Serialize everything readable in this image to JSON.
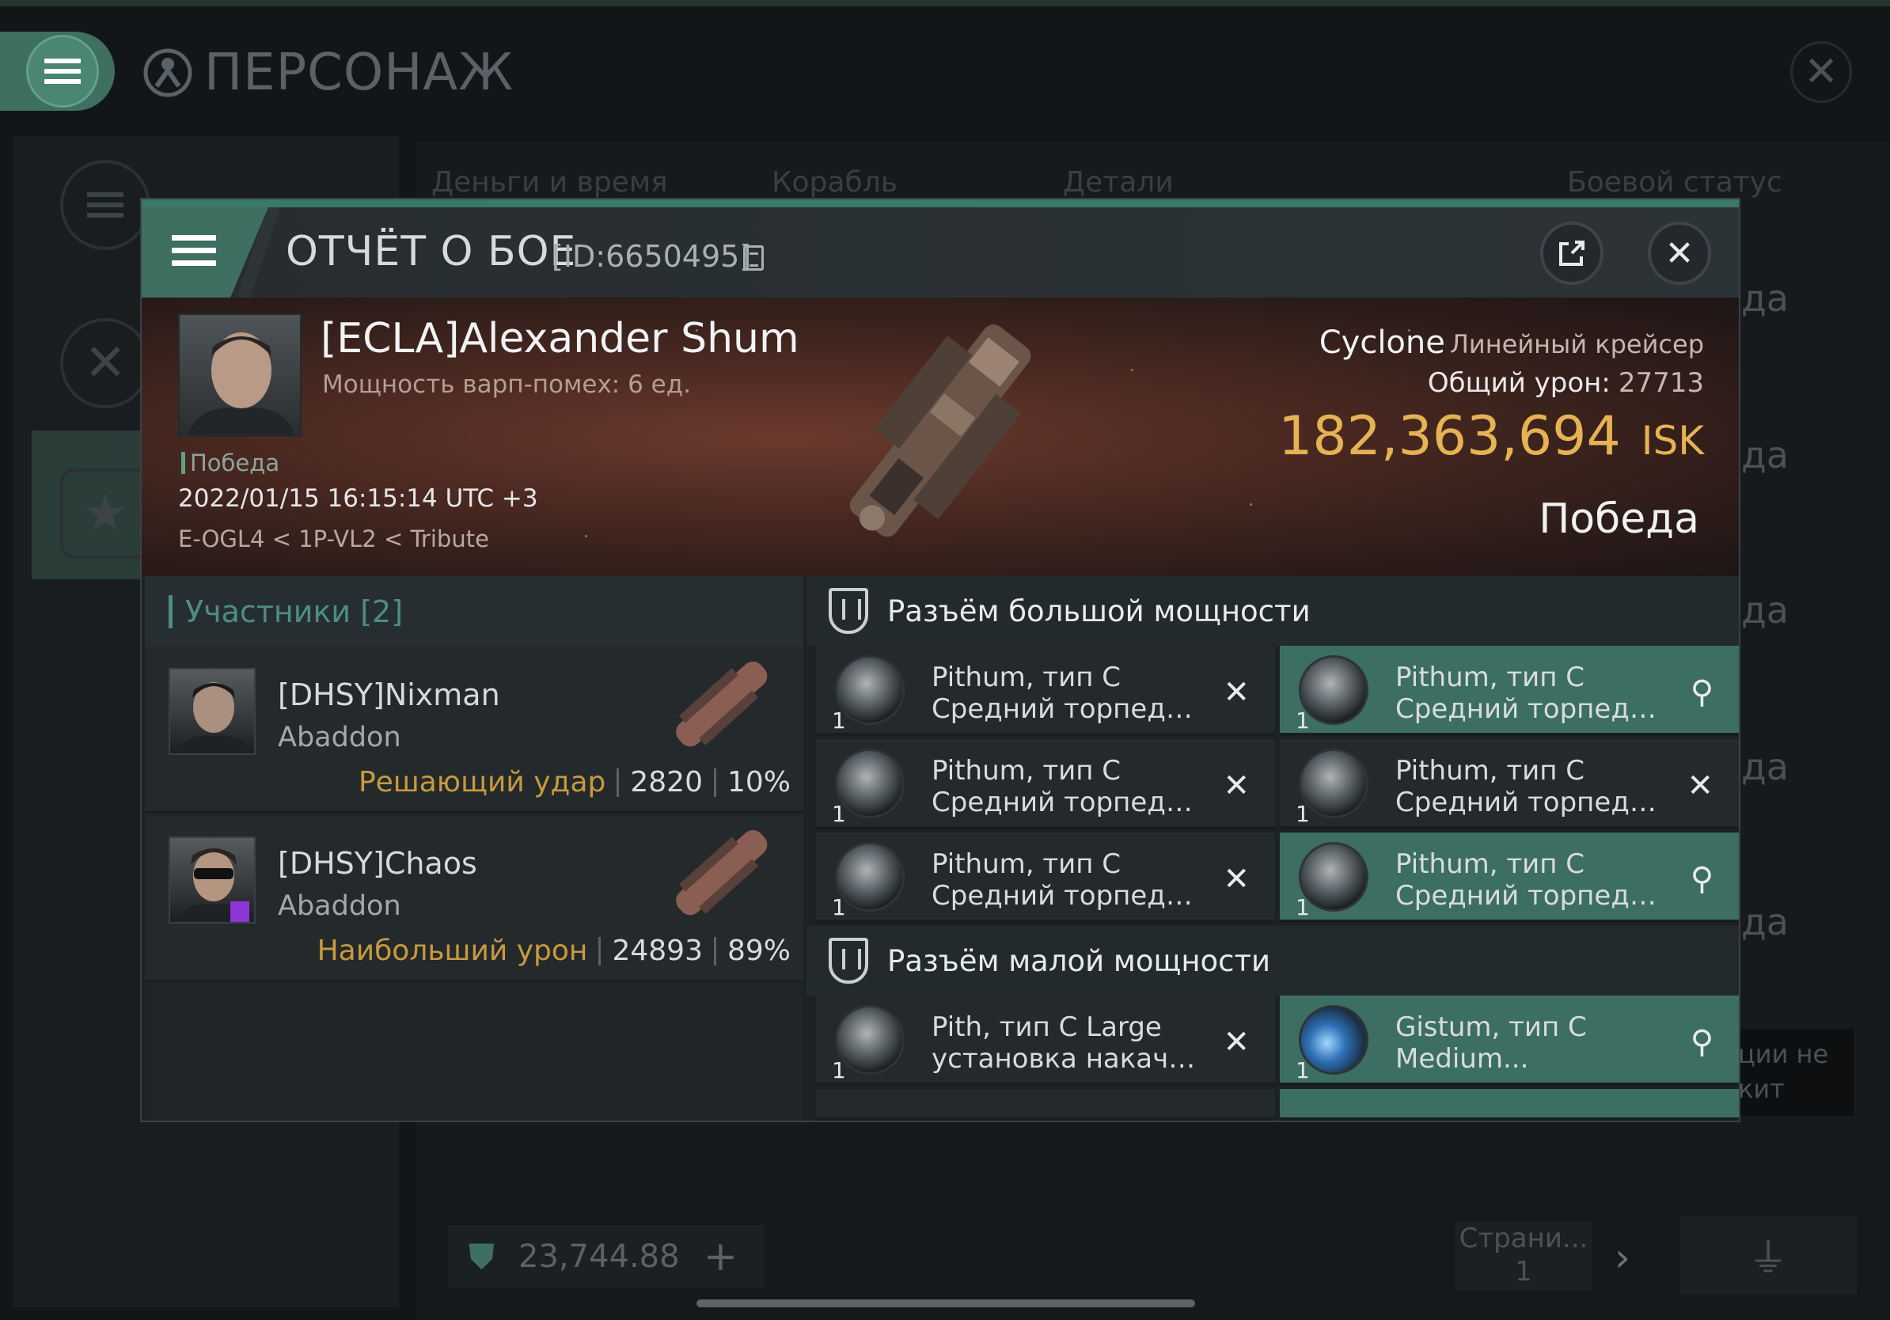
{
  "background": {
    "title": "ПЕРСОНАЖ",
    "columns": [
      "Деньги и время",
      "Корабль",
      "Детали",
      "Боевой статус"
    ],
    "row_status": [
      "да",
      "да",
      "да",
      "да",
      "да"
    ],
    "notice": [
      "ции не",
      "кит"
    ],
    "money": "23,744.88",
    "page_label": "Страни...",
    "page_number": "1"
  },
  "report": {
    "title": "ОТЧЁТ О БОЕ",
    "id": "[ID:6650495]",
    "victim": {
      "name": "[ECLA]Alexander Shum",
      "warp": "Мощность варп-помех: 6 ед.",
      "result_label": "Победа",
      "date": "2022/01/15 16:15:14 UTC +3",
      "location": "E-OGL4 < 1P-VL2 < Tribute",
      "ship": "Cyclone",
      "ship_class": "Линейный крейсер",
      "damage_label": "Общий урон:",
      "damage": "27713",
      "isk_value": "182,363,694",
      "isk_unit": "ISK",
      "result": "Победа"
    },
    "participants": {
      "header": "Участники [2]",
      "items": [
        {
          "name": "[DHSY]Nixman",
          "ship": "Abaddon",
          "tag": "Решающий удар",
          "damage": "2820",
          "percent": "10%"
        },
        {
          "name": "[DHSY]Chaos",
          "ship": "Abaddon",
          "tag": "Наибольший урон",
          "damage": "24893",
          "percent": "89%"
        }
      ]
    },
    "fitting": {
      "high_slots_label": "Разъём большой мощности",
      "low_slots_label": "Разъём малой мощности",
      "high": [
        {
          "qty": "1",
          "l1": "Pithum, тип C",
          "l2": "Средний торпедный ...",
          "state": "destroyed"
        },
        {
          "qty": "1",
          "l1": "Pithum, тип C",
          "l2": "Средний торпедный ...",
          "state": "dropped"
        },
        {
          "qty": "1",
          "l1": "Pithum, тип C",
          "l2": "Средний торпедный ...",
          "state": "destroyed"
        },
        {
          "qty": "1",
          "l1": "Pithum, тип C",
          "l2": "Средний торпедный ...",
          "state": "destroyed"
        },
        {
          "qty": "1",
          "l1": "Pithum, тип C",
          "l2": "Средний торпедный ...",
          "state": "destroyed"
        },
        {
          "qty": "1",
          "l1": "Pithum, тип C",
          "l2": "Средний торпедный ...",
          "state": "dropped"
        }
      ],
      "low": [
        {
          "qty": "1",
          "l1": "Pith, тип C Large",
          "l2": "установка накачки...",
          "state": "destroyed"
        },
        {
          "qty": "1",
          "l1": "Gistum, тип C",
          "l2": "Medium...",
          "state": "dropped"
        }
      ]
    }
  },
  "colors": {
    "accent": "#3e6f60",
    "isk": "#e6b354",
    "tag": "#c89a3e",
    "participants": "#4d8e82"
  }
}
